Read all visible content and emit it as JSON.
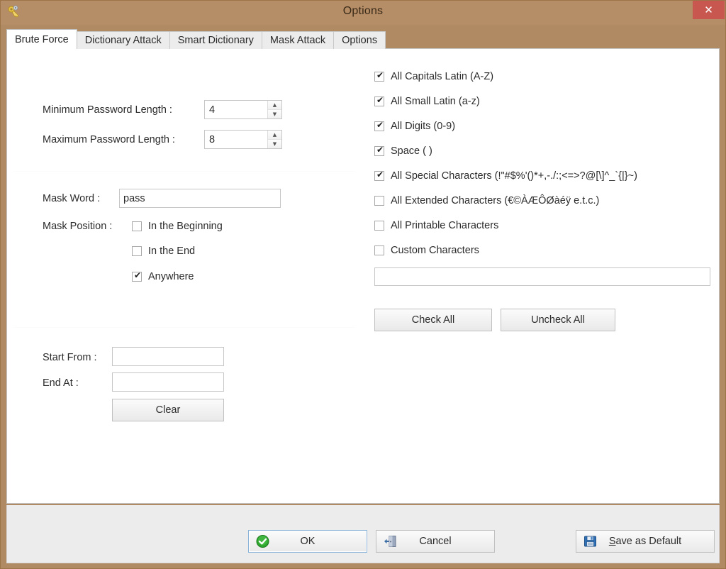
{
  "window": {
    "title": "Options",
    "app_icon": "keys-icon",
    "close_label": "✕",
    "titlebar_color": "#b58d66",
    "close_color": "#c8574f"
  },
  "tabs": [
    {
      "label": "Brute Force",
      "active": true
    },
    {
      "label": "Dictionary Attack",
      "active": false
    },
    {
      "label": "Smart Dictionary",
      "active": false
    },
    {
      "label": "Mask Attack",
      "active": false
    },
    {
      "label": "Options",
      "active": false
    }
  ],
  "left_panel": {
    "min_length": {
      "label": "Minimum Password Length :",
      "value": "4"
    },
    "max_length": {
      "label": "Maximum Password Length :",
      "value": "8"
    },
    "mask_word": {
      "label": "Mask Word :",
      "value": "pass",
      "placeholder": ""
    },
    "mask_position": {
      "label": "Mask Position :",
      "options": [
        {
          "label": "In the Beginning",
          "checked": false
        },
        {
          "label": "In the End",
          "checked": false
        },
        {
          "label": "Anywhere",
          "checked": true
        }
      ]
    },
    "start_from": {
      "label": "Start From :",
      "value": "",
      "placeholder": ""
    },
    "end_at": {
      "label": "End At :",
      "value": "",
      "placeholder": ""
    },
    "clear_button": "Clear"
  },
  "right_panel": {
    "charsets": [
      {
        "label": "All Capitals Latin (A-Z)",
        "checked": true
      },
      {
        "label": "All Small Latin (a-z)",
        "checked": true
      },
      {
        "label": "All Digits (0-9)",
        "checked": true
      },
      {
        "label": "Space ( )",
        "checked": true
      },
      {
        "label": "All Special Characters (!\"#$%'()*+,-./:;<=>?@[\\]^_`{|}~)",
        "checked": true
      },
      {
        "label": "All Extended Characters (€©ÀÆÔØàéÿ e.t.c.)",
        "checked": false
      },
      {
        "label": "All Printable Characters",
        "checked": false
      },
      {
        "label": "Custom Characters",
        "checked": false
      }
    ],
    "custom_input": {
      "value": "",
      "placeholder": ""
    },
    "check_all_button": "Check All",
    "uncheck_all_button": "Uncheck All"
  },
  "footer": {
    "ok_button": {
      "label": "OK",
      "icon": "green-check-icon",
      "focused": true
    },
    "cancel_button": {
      "label": "Cancel",
      "icon": "exit-door-icon"
    },
    "save_default_button": {
      "accel": "S",
      "label": "ave as Default",
      "icon": "floppy-save-icon"
    }
  }
}
